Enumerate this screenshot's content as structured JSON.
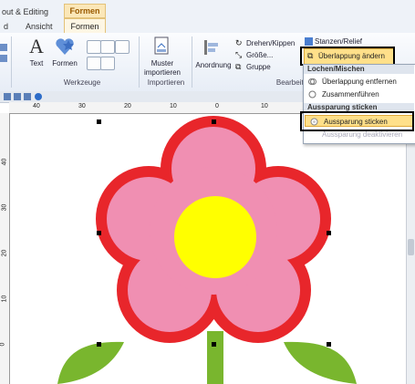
{
  "tabs": {
    "t1": "out & Editing",
    "t2": "d",
    "t3": "Ansicht",
    "ctx_header": "Formen",
    "ctx_tab": "Formen"
  },
  "ribbon": {
    "text_btn": "Text",
    "formen_btn": "Formen",
    "werkzeuge_group": "Werkzeuge",
    "muster_btn_1": "Muster",
    "muster_btn_2": "importieren",
    "importieren_group": "Importieren",
    "anordnung_btn": "Anordnung",
    "drehen_btn": "Drehen/Kippen",
    "groesse_btn": "Größe...",
    "gruppe_btn": "Gruppe",
    "stanzen_btn": "Stanzen/Relief",
    "bearbeiten_group": "Bearbeite",
    "ueberlappung_btn": "Überlappung ändern"
  },
  "menu": {
    "head1": "Lochen/Mischen",
    "items": [
      "Überlappung entfernen",
      "Zusammenführen"
    ],
    "head2": "Aussparung sticken",
    "aussparung": "Aussparung sticken",
    "deaktivieren": "Aussparung deaktivieren"
  },
  "ruler": {
    "h": [
      "40",
      "30",
      "20",
      "10",
      "0",
      "10"
    ],
    "v": [
      "40",
      "30",
      "20",
      "10",
      "0"
    ]
  },
  "colors": {
    "petal": "#f08fb2",
    "outline": "#e8262b",
    "center": "#ffff00",
    "stem": "#79b62e",
    "highlight": "#000000",
    "context_tab": "#fbe7b8"
  }
}
